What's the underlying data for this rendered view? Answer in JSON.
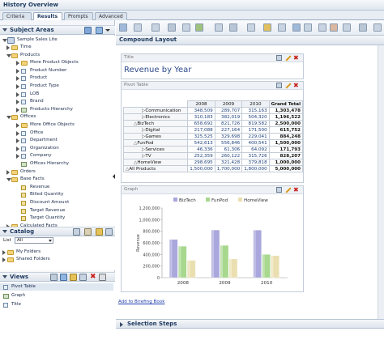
{
  "window": {
    "title": "History Overview"
  },
  "tabs": [
    {
      "label": "Criteria",
      "active": false
    },
    {
      "label": "Results",
      "active": true
    },
    {
      "label": "Prompts",
      "active": false
    },
    {
      "label": "Advanced",
      "active": false
    }
  ],
  "subject_areas": {
    "title": "Subject Areas",
    "root": "Sample Sales Lite",
    "items": [
      {
        "label": "Time",
        "kind": "folder",
        "level": 1,
        "expander": "closed"
      },
      {
        "label": "Products",
        "kind": "folder",
        "level": 1,
        "expander": "open"
      },
      {
        "label": "More Product Objects",
        "kind": "folder",
        "level": 2,
        "expander": "closed"
      },
      {
        "label": "Product Number",
        "kind": "column",
        "level": 2,
        "expander": "closed"
      },
      {
        "label": "Product",
        "kind": "column",
        "level": 2,
        "expander": "closed"
      },
      {
        "label": "Product Type",
        "kind": "column",
        "level": 2,
        "expander": "closed"
      },
      {
        "label": "LOB",
        "kind": "column",
        "level": 2,
        "expander": "closed"
      },
      {
        "label": "Brand",
        "kind": "column",
        "level": 2,
        "expander": "closed"
      },
      {
        "label": "Products Hierarchy",
        "kind": "hierarchy",
        "level": 2,
        "expander": "closed"
      },
      {
        "label": "Offices",
        "kind": "folder",
        "level": 1,
        "expander": "open"
      },
      {
        "label": "More Office Objects",
        "kind": "folder",
        "level": 2,
        "expander": "closed"
      },
      {
        "label": "Office",
        "kind": "column",
        "level": 2,
        "expander": "closed"
      },
      {
        "label": "Department",
        "kind": "column",
        "level": 2,
        "expander": "closed"
      },
      {
        "label": "Organization",
        "kind": "column",
        "level": 2,
        "expander": "closed"
      },
      {
        "label": "Company",
        "kind": "column",
        "level": 2,
        "expander": "closed"
      },
      {
        "label": "Offices Hierarchy",
        "kind": "hierarchy",
        "level": 2,
        "expander": "none"
      },
      {
        "label": "Orders",
        "kind": "folder",
        "level": 1,
        "expander": "closed"
      },
      {
        "label": "Base Facts",
        "kind": "folder",
        "level": 1,
        "expander": "open"
      },
      {
        "label": "Revenue",
        "kind": "fact",
        "level": 2,
        "expander": "none"
      },
      {
        "label": "Billed Quantity",
        "kind": "fact",
        "level": 2,
        "expander": "none"
      },
      {
        "label": "Discount Amount",
        "kind": "fact",
        "level": 2,
        "expander": "none"
      },
      {
        "label": "Target Revenue",
        "kind": "fact",
        "level": 2,
        "expander": "none"
      },
      {
        "label": "Target Quantity",
        "kind": "fact",
        "level": 2,
        "expander": "none"
      },
      {
        "label": "Calculated Facts",
        "kind": "folder",
        "level": 1,
        "expander": "closed"
      }
    ]
  },
  "catalog": {
    "title": "Catalog",
    "list_label": "List",
    "list_value": "All",
    "items": [
      "My Folders",
      "Shared Folders"
    ]
  },
  "views": {
    "title": "Views",
    "items": [
      "Pivot Table",
      "Graph",
      "Title"
    ]
  },
  "compound_layout": {
    "header": "Compound Layout",
    "title_view": {
      "label": "Title",
      "text": "Revenue by Year"
    },
    "pivot_view": {
      "label": "Pivot Table",
      "columns": [
        "2008",
        "2009",
        "2010",
        "Grand Total"
      ],
      "rows": [
        {
          "label": "Communication",
          "prefix": "▷",
          "indent": 2,
          "values": [
            "348,509",
            "289,707",
            "315,163",
            "1,303,478"
          ]
        },
        {
          "label": "Electronics",
          "prefix": "▷",
          "indent": 2,
          "values": [
            "310,183",
            "382,019",
            "504,320",
            "1,196,522"
          ]
        },
        {
          "label": "BizTech",
          "prefix": "△",
          "indent": 1,
          "values": [
            "658,692",
            "821,726",
            "819,582",
            "2,500,000"
          ]
        },
        {
          "label": "Digital",
          "prefix": "▷",
          "indent": 2,
          "values": [
            "217,088",
            "227,164",
            "171,500",
            "615,752"
          ]
        },
        {
          "label": "Games",
          "prefix": "▷",
          "indent": 2,
          "values": [
            "325,525",
            "329,698",
            "229,041",
            "884,248"
          ]
        },
        {
          "label": "FunPod",
          "prefix": "△",
          "indent": 1,
          "values": [
            "542,613",
            "556,846",
            "400,541",
            "1,500,000"
          ]
        },
        {
          "label": "Services",
          "prefix": "▷",
          "indent": 2,
          "values": [
            "46,336",
            "61,306",
            "64,092",
            "171,793"
          ]
        },
        {
          "label": "TV",
          "prefix": "▷",
          "indent": 2,
          "values": [
            "252,359",
            "260,122",
            "315,726",
            "828,207"
          ]
        },
        {
          "label": "HomeView",
          "prefix": "△",
          "indent": 1,
          "values": [
            "298,695",
            "321,428",
            "379,818",
            "1,000,000"
          ]
        },
        {
          "label": "All Products",
          "prefix": "△",
          "indent": 0,
          "values": [
            "1,500,000",
            "1,700,000",
            "1,800,000",
            "5,000,000"
          ]
        }
      ]
    },
    "graph_view": {
      "label": "Graph"
    },
    "briefing_link": "Add to Briefing Book"
  },
  "selection_steps": {
    "title": "Selection Steps"
  },
  "chart_data": {
    "type": "bar",
    "categories": [
      "2008",
      "2009",
      "2010"
    ],
    "series": [
      {
        "name": "BizTech",
        "values": [
          658692,
          821726,
          819582
        ],
        "color": "#a9a7dc"
      },
      {
        "name": "FunPod",
        "values": [
          542613,
          556846,
          400541
        ],
        "color": "#a7d88e"
      },
      {
        "name": "HomeView",
        "values": [
          298695,
          321428,
          379818
        ],
        "color": "#eadfb0"
      }
    ],
    "xlabel": "",
    "ylabel": "Revenue",
    "ylim": [
      0,
      1200000
    ],
    "yticks": [
      "0",
      "200,000",
      "400,000",
      "600,000",
      "800,000",
      "1,000,000",
      "1,200,000"
    ],
    "legend": "top",
    "grid": false
  },
  "colors": {
    "accent": "#1e3a60",
    "title_text": "#2d4a8c",
    "link": "#1f3fae"
  }
}
